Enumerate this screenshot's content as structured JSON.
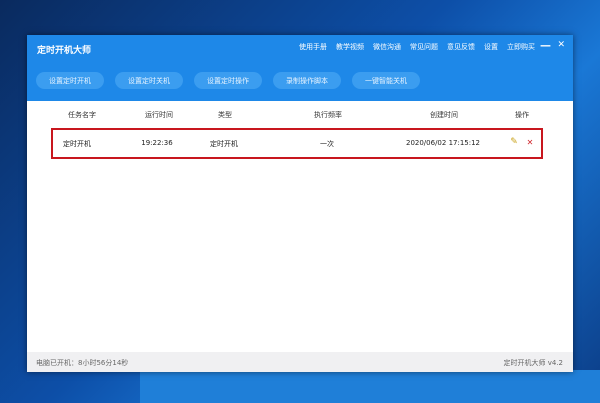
{
  "app": {
    "title": "定时开机大师",
    "minimize_icon": "—",
    "close_icon": "✕"
  },
  "menu": [
    "使用手册",
    "教学视频",
    "微信沟通",
    "常见问题",
    "意见反馈",
    "设置",
    "立即购买"
  ],
  "toolbar": [
    "设置定时开机",
    "设置定时关机",
    "设置定时操作",
    "录制操作脚本",
    "一键智能关机"
  ],
  "table": {
    "headers": [
      "任务名字",
      "运行时间",
      "类型",
      "执行频率",
      "创建时间",
      "操作"
    ],
    "rows": [
      {
        "name": "定时开机",
        "time": "19:22:36",
        "type": "定时开机",
        "freq": "一次",
        "created": "2020/06/02 17:15:12",
        "edit_icon": "✎",
        "delete_icon": "✕"
      }
    ]
  },
  "status": {
    "uptime": "电脑已开机：8小时56分14秒",
    "version": "定时开机大师 v4.2"
  }
}
